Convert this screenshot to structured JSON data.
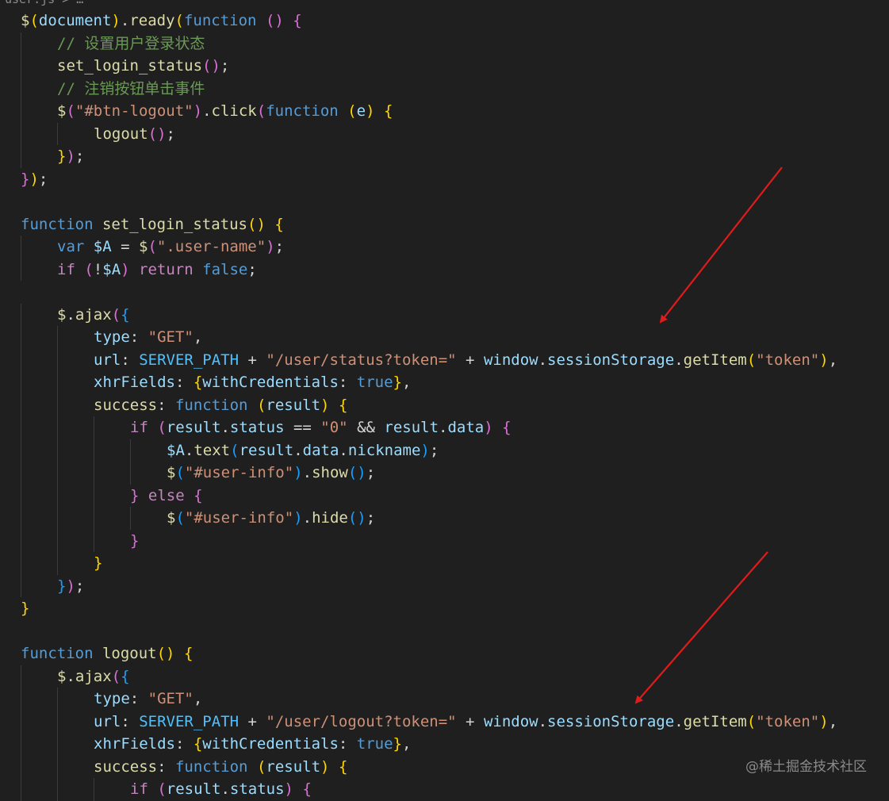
{
  "breadcrumb": "user.js > …",
  "watermark": "@稀土掘金技术社区",
  "colors": {
    "background": "#1f1f1f",
    "arrow": "#e01b1b"
  },
  "code_lines": [
    {
      "indent": 0,
      "tokens": [
        [
          "$",
          "#dcdcaa"
        ],
        [
          "(",
          "#ffd700"
        ],
        [
          "document",
          "#9cdcfe"
        ],
        [
          ")",
          "#ffd700"
        ],
        [
          ".",
          "#d4d4d4"
        ],
        [
          "ready",
          "#dcdcaa"
        ],
        [
          "(",
          "#ffd700"
        ],
        [
          "function",
          "#569cd6"
        ],
        [
          " ",
          "#d4d4d4"
        ],
        [
          "()",
          "#da70d6"
        ],
        [
          " ",
          "#d4d4d4"
        ],
        [
          "{",
          "#da70d6"
        ]
      ]
    },
    {
      "indent": 1,
      "tokens": [
        [
          "// 设置用户登录状态",
          "#6a9955"
        ]
      ]
    },
    {
      "indent": 1,
      "tokens": [
        [
          "set_login_status",
          "#dcdcaa"
        ],
        [
          "()",
          "#da70d6"
        ],
        [
          ";",
          "#d4d4d4"
        ]
      ]
    },
    {
      "indent": 1,
      "tokens": [
        [
          "// 注销按钮单击事件",
          "#6a9955"
        ]
      ]
    },
    {
      "indent": 1,
      "tokens": [
        [
          "$",
          "#dcdcaa"
        ],
        [
          "(",
          "#da70d6"
        ],
        [
          "\"#btn-logout\"",
          "#ce9178"
        ],
        [
          ")",
          "#da70d6"
        ],
        [
          ".",
          "#d4d4d4"
        ],
        [
          "click",
          "#dcdcaa"
        ],
        [
          "(",
          "#da70d6"
        ],
        [
          "function",
          "#569cd6"
        ],
        [
          " ",
          "#d4d4d4"
        ],
        [
          "(",
          "#ffd700"
        ],
        [
          "e",
          "#9cdcfe"
        ],
        [
          ")",
          "#ffd700"
        ],
        [
          " ",
          "#d4d4d4"
        ],
        [
          "{",
          "#ffd700"
        ]
      ]
    },
    {
      "indent": 2,
      "tokens": [
        [
          "logout",
          "#dcdcaa"
        ],
        [
          "()",
          "#da70d6"
        ],
        [
          ";",
          "#d4d4d4"
        ]
      ]
    },
    {
      "indent": 1,
      "tokens": [
        [
          "}",
          "#ffd700"
        ],
        [
          ")",
          "#da70d6"
        ],
        [
          ";",
          "#d4d4d4"
        ]
      ]
    },
    {
      "indent": 0,
      "tokens": [
        [
          "}",
          "#da70d6"
        ],
        [
          ")",
          "#ffd700"
        ],
        [
          ";",
          "#d4d4d4"
        ]
      ]
    },
    {
      "indent": 0,
      "tokens": []
    },
    {
      "indent": 0,
      "tokens": [
        [
          "function",
          "#569cd6"
        ],
        [
          " ",
          "#d4d4d4"
        ],
        [
          "set_login_status",
          "#dcdcaa"
        ],
        [
          "()",
          "#ffd700"
        ],
        [
          " ",
          "#d4d4d4"
        ],
        [
          "{",
          "#ffd700"
        ]
      ]
    },
    {
      "indent": 1,
      "tokens": [
        [
          "var",
          "#569cd6"
        ],
        [
          " ",
          "#d4d4d4"
        ],
        [
          "$A",
          "#9cdcfe"
        ],
        [
          " = ",
          "#d4d4d4"
        ],
        [
          "$",
          "#dcdcaa"
        ],
        [
          "(",
          "#da70d6"
        ],
        [
          "\".user-name\"",
          "#ce9178"
        ],
        [
          ")",
          "#da70d6"
        ],
        [
          ";",
          "#d4d4d4"
        ]
      ]
    },
    {
      "indent": 1,
      "tokens": [
        [
          "if",
          "#c586c0"
        ],
        [
          " ",
          "#d4d4d4"
        ],
        [
          "(",
          "#da70d6"
        ],
        [
          "!",
          "#d4d4d4"
        ],
        [
          "$A",
          "#9cdcfe"
        ],
        [
          ")",
          "#da70d6"
        ],
        [
          " ",
          "#d4d4d4"
        ],
        [
          "return",
          "#c586c0"
        ],
        [
          " ",
          "#d4d4d4"
        ],
        [
          "false",
          "#569cd6"
        ],
        [
          ";",
          "#d4d4d4"
        ]
      ]
    },
    {
      "indent": 0,
      "tokens": []
    },
    {
      "indent": 1,
      "tokens": [
        [
          "$",
          "#dcdcaa"
        ],
        [
          ".",
          "#d4d4d4"
        ],
        [
          "ajax",
          "#dcdcaa"
        ],
        [
          "(",
          "#da70d6"
        ],
        [
          "{",
          "#179fff"
        ]
      ]
    },
    {
      "indent": 2,
      "tokens": [
        [
          "type",
          "#9cdcfe"
        ],
        [
          ": ",
          "#d4d4d4"
        ],
        [
          "\"GET\"",
          "#ce9178"
        ],
        [
          ",",
          "#d4d4d4"
        ]
      ]
    },
    {
      "indent": 2,
      "tokens": [
        [
          "url",
          "#9cdcfe"
        ],
        [
          ": ",
          "#d4d4d4"
        ],
        [
          "SERVER_PATH",
          "#4fc1ff"
        ],
        [
          " + ",
          "#d4d4d4"
        ],
        [
          "\"/user/status?token=\"",
          "#ce9178"
        ],
        [
          " + ",
          "#d4d4d4"
        ],
        [
          "window",
          "#9cdcfe"
        ],
        [
          ".",
          "#d4d4d4"
        ],
        [
          "sessionStorage",
          "#9cdcfe"
        ],
        [
          ".",
          "#d4d4d4"
        ],
        [
          "getItem",
          "#dcdcaa"
        ],
        [
          "(",
          "#ffd700"
        ],
        [
          "\"token\"",
          "#ce9178"
        ],
        [
          ")",
          "#ffd700"
        ],
        [
          ",",
          "#d4d4d4"
        ]
      ]
    },
    {
      "indent": 2,
      "tokens": [
        [
          "xhrFields",
          "#9cdcfe"
        ],
        [
          ": ",
          "#d4d4d4"
        ],
        [
          "{",
          "#ffd700"
        ],
        [
          "withCredentials",
          "#9cdcfe"
        ],
        [
          ": ",
          "#d4d4d4"
        ],
        [
          "true",
          "#569cd6"
        ],
        [
          "}",
          "#ffd700"
        ],
        [
          ",",
          "#d4d4d4"
        ]
      ]
    },
    {
      "indent": 2,
      "tokens": [
        [
          "success",
          "#dcdcaa"
        ],
        [
          ": ",
          "#d4d4d4"
        ],
        [
          "function",
          "#569cd6"
        ],
        [
          " ",
          "#d4d4d4"
        ],
        [
          "(",
          "#ffd700"
        ],
        [
          "result",
          "#9cdcfe"
        ],
        [
          ")",
          "#ffd700"
        ],
        [
          " ",
          "#d4d4d4"
        ],
        [
          "{",
          "#ffd700"
        ]
      ]
    },
    {
      "indent": 3,
      "tokens": [
        [
          "if",
          "#c586c0"
        ],
        [
          " ",
          "#d4d4d4"
        ],
        [
          "(",
          "#da70d6"
        ],
        [
          "result",
          "#9cdcfe"
        ],
        [
          ".",
          "#d4d4d4"
        ],
        [
          "status",
          "#9cdcfe"
        ],
        [
          " == ",
          "#d4d4d4"
        ],
        [
          "\"0\"",
          "#ce9178"
        ],
        [
          " && ",
          "#d4d4d4"
        ],
        [
          "result",
          "#9cdcfe"
        ],
        [
          ".",
          "#d4d4d4"
        ],
        [
          "data",
          "#9cdcfe"
        ],
        [
          ")",
          "#da70d6"
        ],
        [
          " ",
          "#d4d4d4"
        ],
        [
          "{",
          "#da70d6"
        ]
      ]
    },
    {
      "indent": 4,
      "tokens": [
        [
          "$A",
          "#9cdcfe"
        ],
        [
          ".",
          "#d4d4d4"
        ],
        [
          "text",
          "#dcdcaa"
        ],
        [
          "(",
          "#179fff"
        ],
        [
          "result",
          "#9cdcfe"
        ],
        [
          ".",
          "#d4d4d4"
        ],
        [
          "data",
          "#9cdcfe"
        ],
        [
          ".",
          "#d4d4d4"
        ],
        [
          "nickname",
          "#9cdcfe"
        ],
        [
          ")",
          "#179fff"
        ],
        [
          ";",
          "#d4d4d4"
        ]
      ]
    },
    {
      "indent": 4,
      "tokens": [
        [
          "$",
          "#dcdcaa"
        ],
        [
          "(",
          "#179fff"
        ],
        [
          "\"#user-info\"",
          "#ce9178"
        ],
        [
          ")",
          "#179fff"
        ],
        [
          ".",
          "#d4d4d4"
        ],
        [
          "show",
          "#dcdcaa"
        ],
        [
          "()",
          "#179fff"
        ],
        [
          ";",
          "#d4d4d4"
        ]
      ]
    },
    {
      "indent": 3,
      "tokens": [
        [
          "}",
          "#da70d6"
        ],
        [
          " ",
          "#d4d4d4"
        ],
        [
          "else",
          "#c586c0"
        ],
        [
          " ",
          "#d4d4d4"
        ],
        [
          "{",
          "#da70d6"
        ]
      ]
    },
    {
      "indent": 4,
      "tokens": [
        [
          "$",
          "#dcdcaa"
        ],
        [
          "(",
          "#179fff"
        ],
        [
          "\"#user-info\"",
          "#ce9178"
        ],
        [
          ")",
          "#179fff"
        ],
        [
          ".",
          "#d4d4d4"
        ],
        [
          "hide",
          "#dcdcaa"
        ],
        [
          "()",
          "#179fff"
        ],
        [
          ";",
          "#d4d4d4"
        ]
      ]
    },
    {
      "indent": 3,
      "tokens": [
        [
          "}",
          "#da70d6"
        ]
      ]
    },
    {
      "indent": 2,
      "tokens": [
        [
          "}",
          "#ffd700"
        ]
      ]
    },
    {
      "indent": 1,
      "tokens": [
        [
          "}",
          "#179fff"
        ],
        [
          ")",
          "#da70d6"
        ],
        [
          ";",
          "#d4d4d4"
        ]
      ]
    },
    {
      "indent": 0,
      "tokens": [
        [
          "}",
          "#ffd700"
        ]
      ]
    },
    {
      "indent": 0,
      "tokens": []
    },
    {
      "indent": 0,
      "tokens": [
        [
          "function",
          "#569cd6"
        ],
        [
          " ",
          "#d4d4d4"
        ],
        [
          "logout",
          "#dcdcaa"
        ],
        [
          "()",
          "#ffd700"
        ],
        [
          " ",
          "#d4d4d4"
        ],
        [
          "{",
          "#ffd700"
        ]
      ]
    },
    {
      "indent": 1,
      "tokens": [
        [
          "$",
          "#dcdcaa"
        ],
        [
          ".",
          "#d4d4d4"
        ],
        [
          "ajax",
          "#dcdcaa"
        ],
        [
          "(",
          "#da70d6"
        ],
        [
          "{",
          "#179fff"
        ]
      ]
    },
    {
      "indent": 2,
      "tokens": [
        [
          "type",
          "#9cdcfe"
        ],
        [
          ": ",
          "#d4d4d4"
        ],
        [
          "\"GET\"",
          "#ce9178"
        ],
        [
          ",",
          "#d4d4d4"
        ]
      ]
    },
    {
      "indent": 2,
      "tokens": [
        [
          "url",
          "#9cdcfe"
        ],
        [
          ": ",
          "#d4d4d4"
        ],
        [
          "SERVER_PATH",
          "#4fc1ff"
        ],
        [
          " + ",
          "#d4d4d4"
        ],
        [
          "\"/user/logout?token=\"",
          "#ce9178"
        ],
        [
          " + ",
          "#d4d4d4"
        ],
        [
          "window",
          "#9cdcfe"
        ],
        [
          ".",
          "#d4d4d4"
        ],
        [
          "sessionStorage",
          "#9cdcfe"
        ],
        [
          ".",
          "#d4d4d4"
        ],
        [
          "getItem",
          "#dcdcaa"
        ],
        [
          "(",
          "#ffd700"
        ],
        [
          "\"token\"",
          "#ce9178"
        ],
        [
          ")",
          "#ffd700"
        ],
        [
          ",",
          "#d4d4d4"
        ]
      ]
    },
    {
      "indent": 2,
      "tokens": [
        [
          "xhrFields",
          "#9cdcfe"
        ],
        [
          ": ",
          "#d4d4d4"
        ],
        [
          "{",
          "#ffd700"
        ],
        [
          "withCredentials",
          "#9cdcfe"
        ],
        [
          ": ",
          "#d4d4d4"
        ],
        [
          "true",
          "#569cd6"
        ],
        [
          "}",
          "#ffd700"
        ],
        [
          ",",
          "#d4d4d4"
        ]
      ]
    },
    {
      "indent": 2,
      "tokens": [
        [
          "success",
          "#dcdcaa"
        ],
        [
          ": ",
          "#d4d4d4"
        ],
        [
          "function",
          "#569cd6"
        ],
        [
          " ",
          "#d4d4d4"
        ],
        [
          "(",
          "#ffd700"
        ],
        [
          "result",
          "#9cdcfe"
        ],
        [
          ")",
          "#ffd700"
        ],
        [
          " ",
          "#d4d4d4"
        ],
        [
          "{",
          "#ffd700"
        ]
      ]
    },
    {
      "indent": 3,
      "tokens": [
        [
          "if",
          "#c586c0"
        ],
        [
          " ",
          "#d4d4d4"
        ],
        [
          "(",
          "#da70d6"
        ],
        [
          "result",
          "#9cdcfe"
        ],
        [
          ".",
          "#d4d4d4"
        ],
        [
          "status",
          "#9cdcfe"
        ],
        [
          ")",
          "#da70d6"
        ],
        [
          " ",
          "#d4d4d4"
        ],
        [
          "{",
          "#da70d6"
        ]
      ]
    }
  ]
}
